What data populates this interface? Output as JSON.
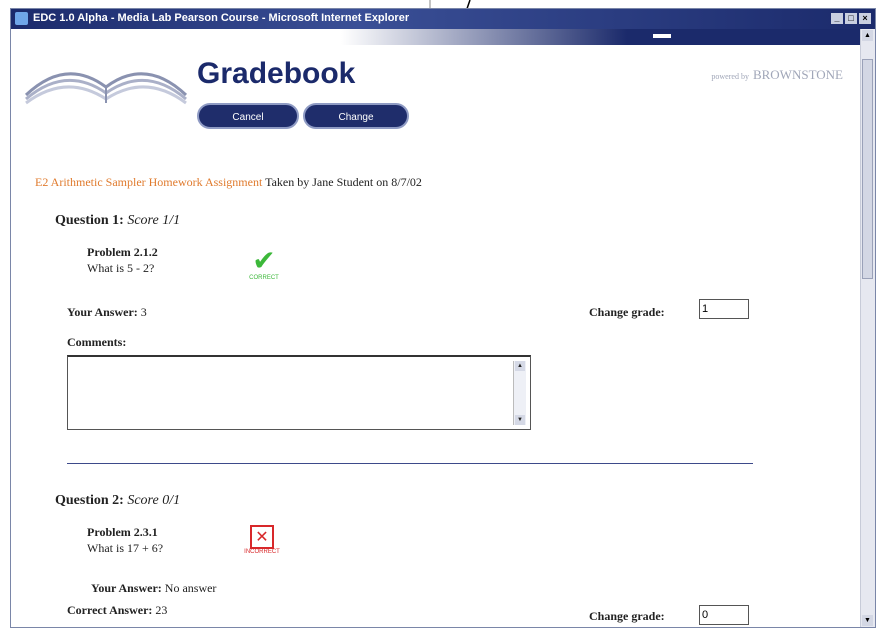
{
  "window": {
    "title": "EDC 1.0 Alpha - Media Lab Pearson Course - Microsoft Internet Explorer",
    "controls": [
      "_",
      "□",
      "×"
    ]
  },
  "header": {
    "app_title": "Gradebook",
    "powered_prefix": "powered by",
    "powered_brand": "BROWNSTONE",
    "cancel_label": "Cancel",
    "change_label": "Change"
  },
  "assignment": {
    "name": "E2 Arithmetic Sampler Homework Assignment",
    "taken_text": " Taken by Jane Student on 8/7/02"
  },
  "questions": [
    {
      "title": "Question 1:",
      "score": "Score 1/1",
      "problem": "Problem 2.1.2",
      "prompt": "What is 5 - 2?",
      "status": "CORRECT",
      "status_icon": "check-icon",
      "your_answer_label": "Your Answer:",
      "your_answer": "3",
      "change_grade_label": "Change grade:",
      "grade_value": "1",
      "comments_label": "Comments:"
    },
    {
      "title": "Question 2:",
      "score": "Score 0/1",
      "problem": "Problem 2.3.1",
      "prompt": "What is 17 + 6?",
      "status": "INCORRECT",
      "status_icon": "x-icon",
      "your_answer_label": "Your Answer:",
      "your_answer": "No answer",
      "correct_answer_label": "Correct Answer:",
      "correct_answer": "23",
      "change_grade_label": "Change grade:",
      "grade_value": "0"
    }
  ],
  "colors": {
    "brand_navy": "#1b2a6b",
    "assignment_orange": "#e07b2e",
    "correct_green": "#3cb83a",
    "incorrect_red": "#d8282a"
  }
}
